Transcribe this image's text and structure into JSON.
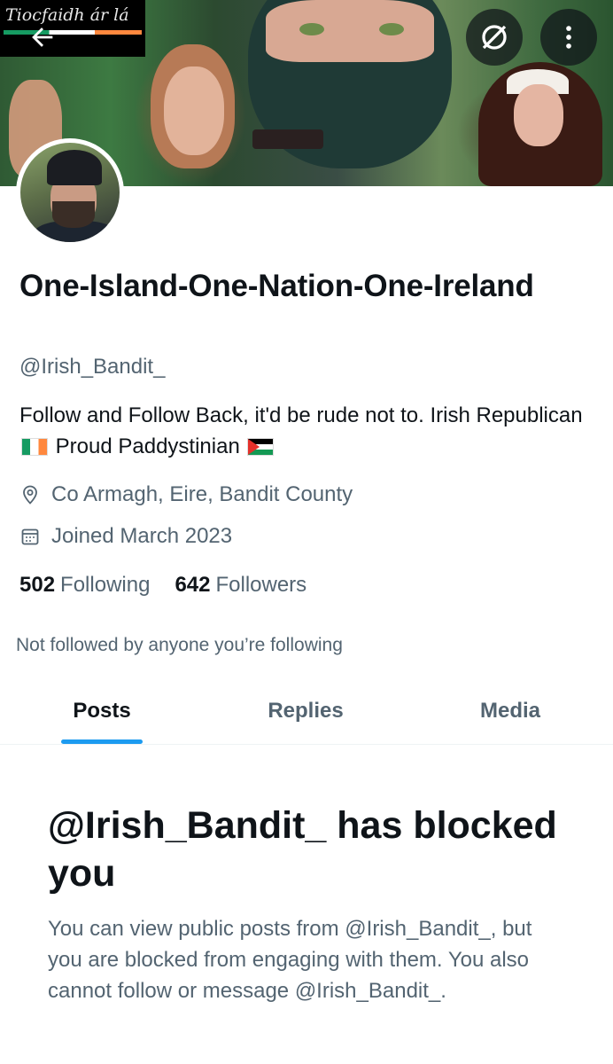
{
  "banner": {
    "watermark_text": "Tiocfaidh ár lá"
  },
  "header": {
    "back_icon": "arrow-left-icon",
    "unblock_icon": "blocked-circle-icon",
    "more_icon": "more-vertical-icon"
  },
  "profile": {
    "name": "One-Island-One-Nation-One-Ireland",
    "handle": "@Irish_Bandit_",
    "bio_part1": "Follow and Follow Back, it'd be rude not to.  Irish Republican ",
    "bio_part2": " Proud Paddystinian ",
    "location": "Co Armagh, Eire, Bandit County",
    "joined": "Joined March 2023",
    "following_count": "502",
    "following_label": "Following",
    "followers_count": "642",
    "followers_label": "Followers",
    "followed_by": "Not followed by anyone you’re following"
  },
  "tabs": [
    {
      "label": "Posts",
      "active": true
    },
    {
      "label": "Replies",
      "active": false
    },
    {
      "label": "Media",
      "active": false
    }
  ],
  "blocked": {
    "title": "@Irish_Bandit_ has blocked you",
    "description": "You can view public posts from @Irish_Bandit_, but you are blocked from engaging with them. You also cannot follow or message @Irish_Bandit_."
  },
  "colors": {
    "accent": "#1d9bf0",
    "text_primary": "#0f1419",
    "text_secondary": "#536471"
  }
}
